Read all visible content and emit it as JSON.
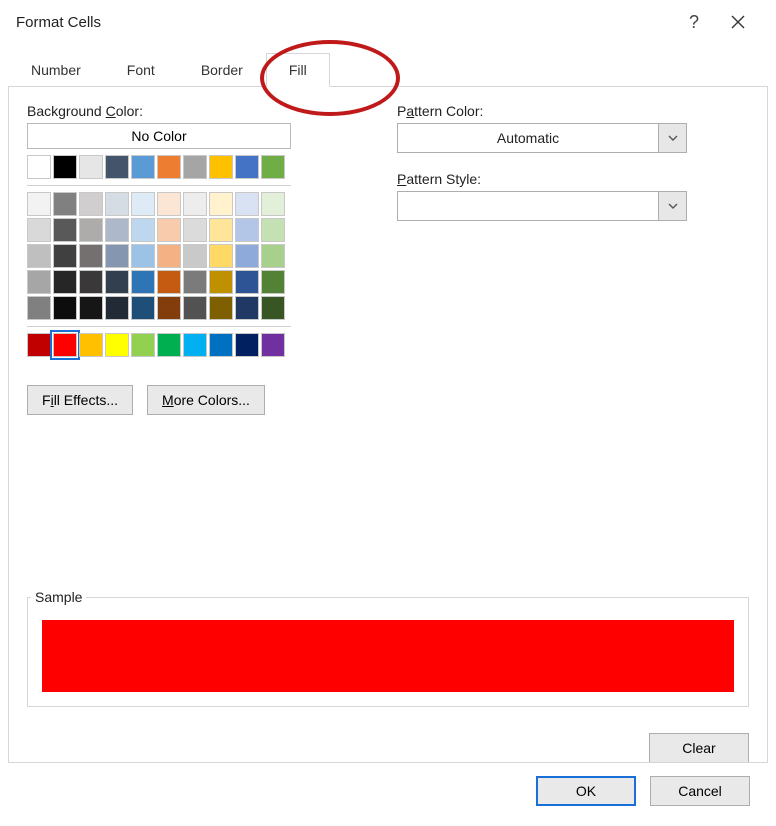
{
  "header": {
    "title": "Format Cells"
  },
  "tabs": [
    "Number",
    "Font",
    "Border",
    "Fill"
  ],
  "active_tab": "Fill",
  "fill": {
    "bg_label_pre": "Background ",
    "bg_label_u": "C",
    "bg_label_post": "olor:",
    "no_color_label": "No Color",
    "fill_effects_pre": "F",
    "fill_effects_u": "i",
    "fill_effects_post": "ll Effects...",
    "more_colors_u": "M",
    "more_colors_post": "ore Colors...",
    "selected_color": "#ff0000",
    "theme_row0": [
      "#ffffff",
      "#000000",
      "#e7e6e6",
      "#44546a",
      "#5b9bd5",
      "#ed7d31",
      "#a5a5a5",
      "#ffc000",
      "#4472c4",
      "#70ad47"
    ],
    "theme_grid": [
      [
        "#f2f2f2",
        "#808080",
        "#d0cece",
        "#d6dce4",
        "#deebf6",
        "#fbe5d5",
        "#ededed",
        "#fff2cc",
        "#d9e2f3",
        "#e2efd9"
      ],
      [
        "#d9d9d9",
        "#595959",
        "#aeabab",
        "#adb9ca",
        "#bdd7ee",
        "#f7cbac",
        "#dbdbdb",
        "#fee599",
        "#b4c6e7",
        "#c5e0b3"
      ],
      [
        "#bfbfbf",
        "#404040",
        "#757070",
        "#8496b0",
        "#9cc3e5",
        "#f4b183",
        "#c9c9c9",
        "#ffd965",
        "#8eaadb",
        "#a8d08d"
      ],
      [
        "#a6a6a6",
        "#262626",
        "#3a3838",
        "#323f4f",
        "#2e75b5",
        "#c55a11",
        "#7b7b7b",
        "#bf9000",
        "#2f5496",
        "#538135"
      ],
      [
        "#808080",
        "#0d0d0d",
        "#171616",
        "#222a35",
        "#1f4e79",
        "#833c0b",
        "#525252",
        "#7f6000",
        "#1f3864",
        "#375623"
      ]
    ],
    "standard": [
      "#c00000",
      "#ff0000",
      "#ffc000",
      "#ffff00",
      "#92d050",
      "#00b050",
      "#00b0f0",
      "#0070c0",
      "#002060",
      "#7030a0"
    ]
  },
  "pattern": {
    "color_label_pre": "P",
    "color_label_u": "a",
    "color_label_post": "ttern Color:",
    "color_value": "Automatic",
    "style_label_u": "P",
    "style_label_post": "attern Style:",
    "style_value": ""
  },
  "sample": {
    "label": "Sample",
    "color": "#ff0000"
  },
  "buttons": {
    "clear": "Clear",
    "ok": "OK",
    "cancel": "Cancel"
  }
}
